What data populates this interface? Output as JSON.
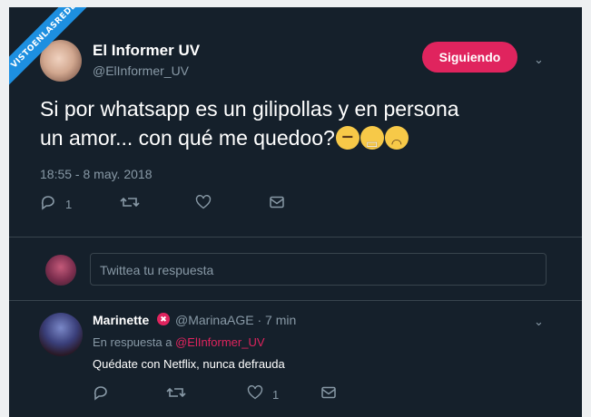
{
  "watermark": "VISTOENLASREDES",
  "tweet": {
    "author_name": "El Informer UV",
    "author_handle": "@ElInformer_UV",
    "follow_label": "Siguiendo",
    "text_line1": "Si por whatsapp es un gilipollas y en persona",
    "text_line2": "un amor... con qué me quedoo?",
    "emojis": [
      "weary-face",
      "grimacing-face",
      "loudly-crying-face"
    ],
    "timestamp": "18:55 - 8 may. 2018",
    "reply_count": "1",
    "icons": [
      "reply-icon",
      "retweet-icon",
      "like-icon",
      "direct-message-icon",
      "chevron-down-icon"
    ]
  },
  "reply_box": {
    "placeholder": "Twittea tu respuesta"
  },
  "reply": {
    "author_name": "Marinette",
    "author_handle_time": "@MarinaAGE · 7 min",
    "in_reply_prefix": "En respuesta a",
    "in_reply_mention": "@ElInformer_UV",
    "text": "Quédate con Netflix, nunca defrauda",
    "like_count": "1"
  },
  "colors": {
    "background": "#15202b",
    "follow_button": "#e0245e",
    "secondary_text": "#8899a6",
    "divider": "#38444d",
    "watermark": "#1d8fe0"
  }
}
